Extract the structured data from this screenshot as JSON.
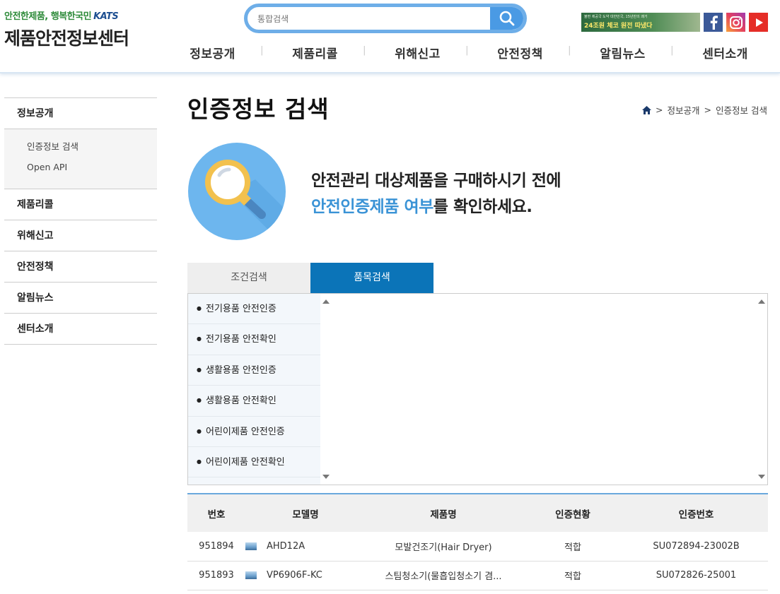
{
  "header": {
    "logo_slogan": "안전한제품, 행복한국민",
    "logo_mark": "KATS",
    "logo_title": "제품안전정보센터",
    "search_placeholder": "통합검색",
    "banner_top": "불편 제공국 도약 대한민국, 15년만의 쾌거",
    "banner_text": "24조원 체코 원전 따냈다",
    "sns": [
      "facebook-icon",
      "instagram-icon",
      "youtube-icon"
    ],
    "nav": [
      "정보공개",
      "제품리콜",
      "위해신고",
      "안전정책",
      "알림뉴스",
      "센터소개"
    ]
  },
  "sidebar": {
    "items": [
      "정보공개",
      "제품리콜",
      "위해신고",
      "안전정책",
      "알림뉴스",
      "센터소개"
    ],
    "sub_items": [
      "인증정보 검색",
      "Open API"
    ]
  },
  "main": {
    "title": "인증정보 검색",
    "breadcrumb": [
      "정보공개",
      "인증정보 검색"
    ],
    "intro_line1": "안전관리 대상제품을 구매하시기 전에",
    "intro_line2_highlight": "안전인증제품 여부",
    "intro_line2_rest": "를 확인하세요.",
    "tabs": [
      "조건검색",
      "품목검색"
    ],
    "active_tab": "품목검색",
    "categories": [
      "전기용품 안전인증",
      "전기용품 안전확인",
      "생활용품 안전인증",
      "생활용품 안전확인",
      "어린이제품 안전인증",
      "어린이제품 안전확인"
    ]
  },
  "table": {
    "headers": [
      "번호",
      "모델명",
      "제품명",
      "인증현황",
      "인증번호"
    ],
    "rows": [
      {
        "no": "951894",
        "model": "AHD12A",
        "product": "모발건조기(Hair Dryer)",
        "status": "적합",
        "cert": "SU072894-23002B"
      },
      {
        "no": "951893",
        "model": "VP6906F-KC",
        "product": "스팀청소기(물흡입청소기 겸...",
        "status": "적합",
        "cert": "SU072826-25001"
      }
    ]
  },
  "colors": {
    "accent": "#0b74b8",
    "search_border": "#6eaee8",
    "highlight_text": "#3a93d6"
  }
}
